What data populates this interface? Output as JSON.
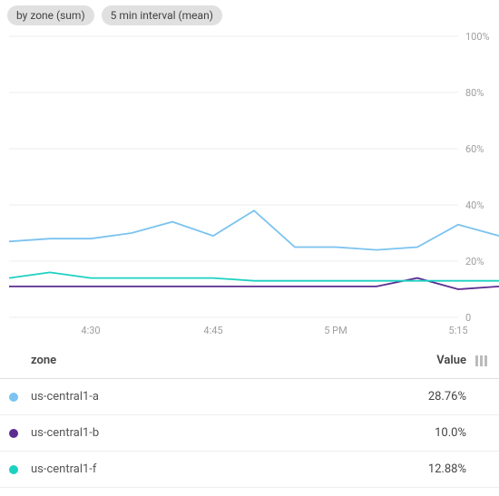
{
  "chips": [
    {
      "label": "by zone (sum)"
    },
    {
      "label": "5 min interval (mean)"
    }
  ],
  "colors": {
    "us-central1-a": "#7bc3f0",
    "us-central1-b": "#5c2d91",
    "us-central1-f": "#1dd1c1"
  },
  "table": {
    "header_zone": "zone",
    "header_value": "Value",
    "rows": [
      {
        "zone": "us-central1-a",
        "value": "28.76%"
      },
      {
        "zone": "us-central1-b",
        "value": "10.0%"
      },
      {
        "zone": "us-central1-f",
        "value": "12.88%"
      }
    ]
  },
  "chart_data": {
    "type": "line",
    "xlabel": "",
    "ylabel": "",
    "ylim": [
      0,
      100
    ],
    "y_ticks": [
      0,
      20,
      40,
      60,
      80,
      100
    ],
    "y_tick_labels": [
      "0",
      "20%",
      "40%",
      "60%",
      "80%",
      "100%"
    ],
    "x_ticks_at": [
      2,
      5,
      8,
      11
    ],
    "x_tick_labels": [
      "4:30",
      "4:45",
      "5 PM",
      "5:15"
    ],
    "x_index_range": [
      0,
      11
    ],
    "series": [
      {
        "name": "us-central1-a",
        "values": [
          27,
          28,
          28,
          30,
          34,
          29,
          38,
          25,
          25,
          24,
          25,
          33,
          29
        ]
      },
      {
        "name": "us-central1-b",
        "values": [
          11,
          11,
          11,
          11,
          11,
          11,
          11,
          11,
          11,
          11,
          14,
          10,
          11
        ]
      },
      {
        "name": "us-central1-f",
        "values": [
          14,
          16,
          14,
          14,
          14,
          14,
          13,
          13,
          13,
          13,
          13,
          13,
          13
        ]
      }
    ]
  }
}
